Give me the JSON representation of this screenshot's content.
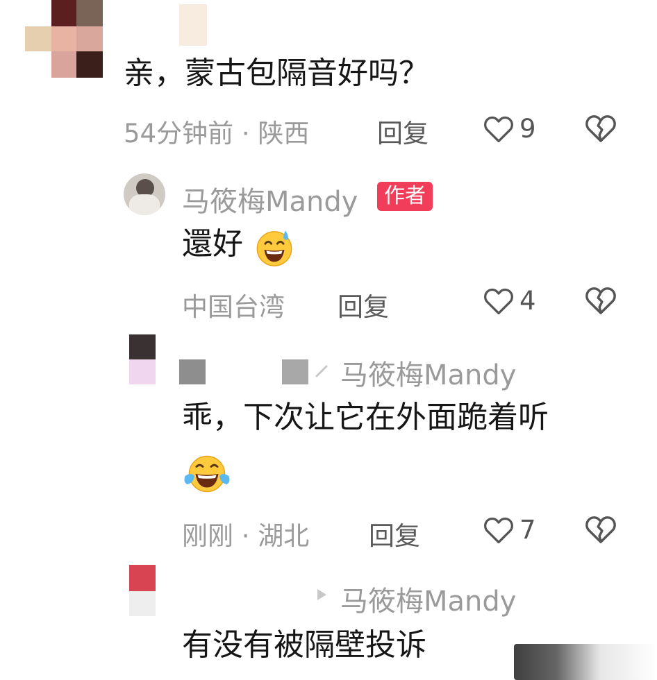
{
  "comments": [
    {
      "text": "亲，蒙古包隔音好吗？",
      "meta": "54分钟前 · 陕西",
      "reply_label": "回复",
      "likes": "9",
      "icons": {
        "like": "heart-outline-icon",
        "dislike": "broken-heart-icon"
      }
    },
    {
      "username": "马筱梅Mandy",
      "badge": "作者",
      "text": "還好",
      "emoji": "grinning-sweat-emoji",
      "meta": "中国台湾",
      "reply_label": "回复",
      "likes": "4"
    },
    {
      "reply_to": "马筱梅Mandy",
      "text_line1": "乖，下次让它在外面跪着听",
      "emoji": "tears-of-joy-emoji",
      "meta": "刚刚 · 湖北",
      "reply_label": "回复",
      "likes": "7"
    },
    {
      "reply_to": "马筱梅Mandy",
      "text": "有没有被隔壁投诉"
    }
  ],
  "colors": {
    "badge": "#f23d5a",
    "meta": "#9a9a9a",
    "text": "#161616"
  }
}
